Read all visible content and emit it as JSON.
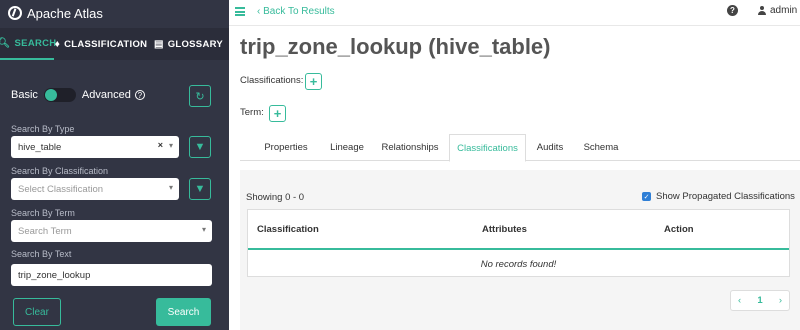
{
  "app": {
    "brand": "Apache Atlas"
  },
  "sidebar": {
    "tabs": [
      {
        "label": "SEARCH",
        "icon": "search-icon",
        "active": true
      },
      {
        "label": "CLASSIFICATION",
        "icon": "tag-icon",
        "active": false
      },
      {
        "label": "GLOSSARY",
        "icon": "book-icon",
        "active": false
      }
    ],
    "mode": {
      "basic_label": "Basic",
      "advanced_label": "Advanced"
    },
    "fields": {
      "type": {
        "label": "Search By Type",
        "value": "hive_table"
      },
      "classification": {
        "label": "Search By Classification",
        "placeholder": "Select Classification"
      },
      "term": {
        "label": "Search By Term",
        "placeholder": "Search Term"
      },
      "text": {
        "label": "Search By Text",
        "value": "trip_zone_lookup"
      }
    },
    "buttons": {
      "clear": "Clear",
      "search": "Search"
    }
  },
  "topbar": {
    "back_label": "Back To Results",
    "user": "admin"
  },
  "entity": {
    "title": "trip_zone_lookup (hive_table)",
    "classifications_label": "Classifications:",
    "term_label": "Term:"
  },
  "tabs": [
    "Properties",
    "Lineage",
    "Relationships",
    "Classifications",
    "Audits",
    "Schema"
  ],
  "active_tab": "Classifications",
  "classifications_panel": {
    "showing": "Showing 0 - 0",
    "show_propagated": "Show Propagated Classifications",
    "show_propagated_checked": true,
    "columns": [
      "Classification",
      "Attributes",
      "Action"
    ],
    "empty_message": "No records found!",
    "page": "1"
  },
  "colors": {
    "accent": "#37bb9b",
    "sidebar_bg": "#323544",
    "checkbox": "#2f7fd6"
  }
}
